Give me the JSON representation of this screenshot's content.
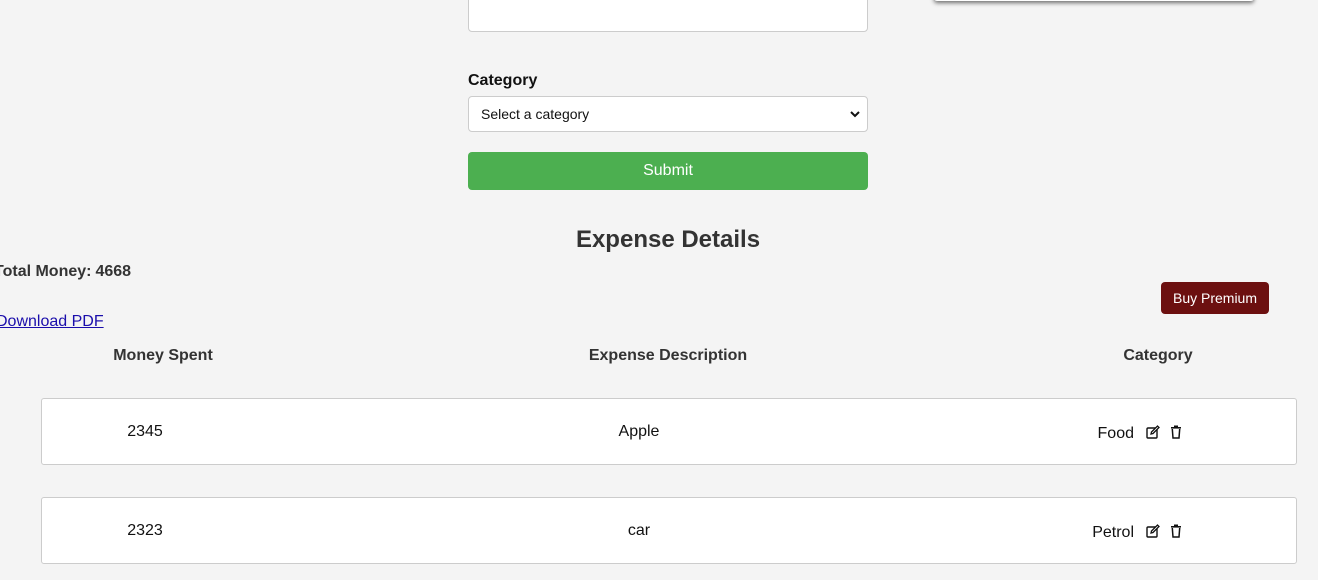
{
  "form": {
    "category_label": "Category",
    "category_select": {
      "selected": "Select a category"
    },
    "submit_label": "Submit"
  },
  "section": {
    "heading": "Expense Details"
  },
  "summary": {
    "total_label": "Total Money:",
    "total_value": "4668",
    "download_label": "Download PDF"
  },
  "premium": {
    "label": "Buy Premium"
  },
  "table": {
    "headers": [
      "Money Spent",
      "Expense Description",
      "Category"
    ],
    "rows": [
      {
        "money": "2345",
        "description": "Apple",
        "category": "Food"
      },
      {
        "money": "2323",
        "description": "car",
        "category": "Petrol"
      }
    ]
  },
  "icons": {
    "edit": "edit-icon",
    "delete": "trash-icon",
    "select_arrow": "chevron-down-icon"
  },
  "colors": {
    "submit": "#4caf50",
    "premium": "#6c1010",
    "link": "#1a0dab",
    "background": "#f4f4f4"
  }
}
